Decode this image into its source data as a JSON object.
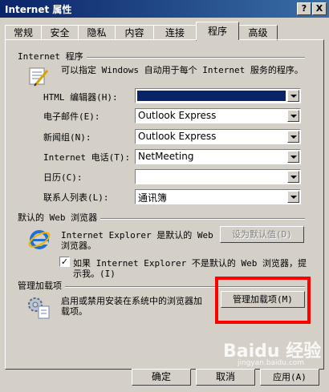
{
  "window": {
    "title": "Internet 属性"
  },
  "titlebar": {
    "help": "?",
    "close": "X"
  },
  "tabs": [
    "常规",
    "安全",
    "隐私",
    "内容",
    "连接",
    "程序",
    "高级"
  ],
  "programs": {
    "group_title": "Internet 程序",
    "description": "可以指定 Windows 自动用于每个 Internet 服务的程序。",
    "rows": [
      {
        "label": "HTML 编辑器(H):",
        "value": ""
      },
      {
        "label": "电子邮件(E):",
        "value": "Outlook Express"
      },
      {
        "label": "新闻组(N):",
        "value": "Outlook Express"
      },
      {
        "label": "Internet 电话(T):",
        "value": "NetMeeting"
      },
      {
        "label": "日历(C):",
        "value": ""
      },
      {
        "label": "联系人列表(L):",
        "value": "通讯簿"
      }
    ]
  },
  "browser": {
    "group_title": "默认的 Web 浏览器",
    "text_line1": "Internet Explorer 是默认的 Web",
    "text_line2": "浏览器。",
    "default_button": "设为默认值(D)",
    "check_mark": "✓",
    "check_line1": "如果 Internet Explorer 不是默认的 Web 浏览器，提",
    "check_line2": "示我。(I)"
  },
  "addons": {
    "group_title": "管理加载项",
    "text_line1": "启用或禁用安装在系统中的浏览器加",
    "text_line2": "载项。",
    "manage_button": "管理加载项(M)"
  },
  "footer": {
    "ok": "确定",
    "cancel": "取消",
    "apply": "应用(A)"
  },
  "watermark": {
    "brand": "Baidu 经验",
    "url": "jingyan.baidu.com"
  },
  "colors": {
    "highlight": "#0a246a",
    "annotation": "#ff0000"
  }
}
